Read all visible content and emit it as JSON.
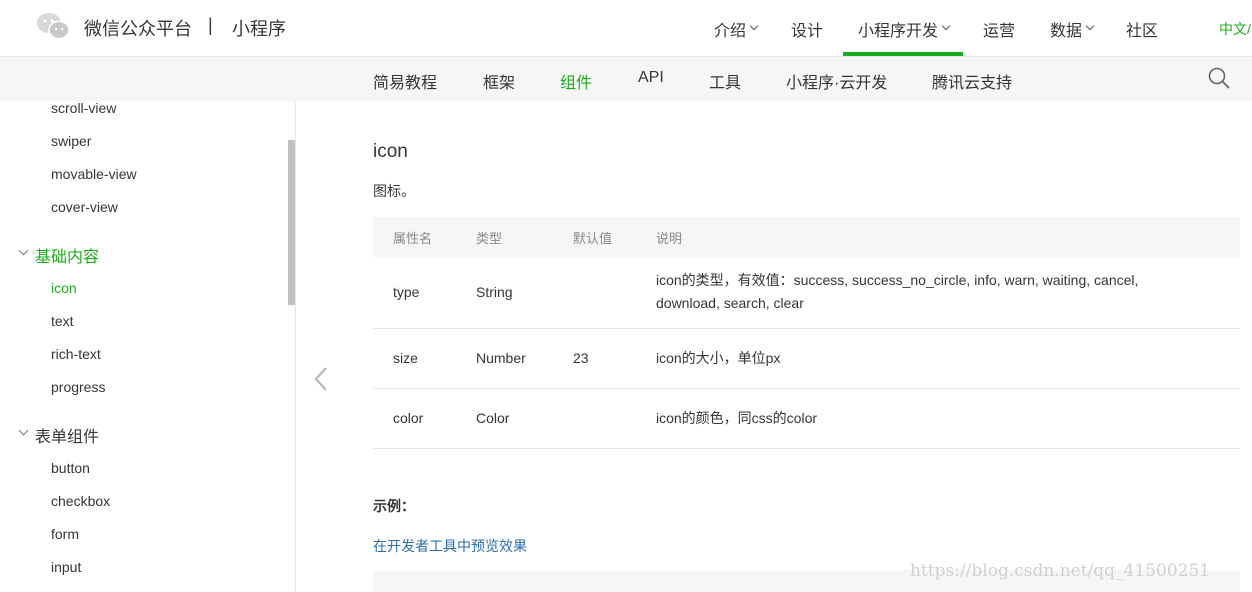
{
  "header": {
    "brand": "微信公众平台",
    "separator": "|",
    "section": "小程序",
    "nav": [
      {
        "label": "介绍",
        "dropdown": true
      },
      {
        "label": "设计",
        "dropdown": false
      },
      {
        "label": "小程序开发",
        "dropdown": true,
        "active": true
      },
      {
        "label": "运营",
        "dropdown": false
      },
      {
        "label": "数据",
        "dropdown": true
      },
      {
        "label": "社区",
        "dropdown": false
      }
    ],
    "lang": "中文/"
  },
  "subnav": {
    "items": [
      "简易教程",
      "框架",
      "组件",
      "API",
      "工具",
      "小程序·云开发",
      "腾讯云支持"
    ],
    "active": "组件"
  },
  "sidebar": {
    "top_items": [
      "scroll-view",
      "swiper",
      "movable-view",
      "cover-view"
    ],
    "group1": {
      "label": "基础内容",
      "items": [
        "icon",
        "text",
        "rich-text",
        "progress"
      ]
    },
    "group2": {
      "label": "表单组件",
      "items": [
        "button",
        "checkbox",
        "form",
        "input"
      ]
    }
  },
  "content": {
    "title": "icon",
    "description": "图标。",
    "table": {
      "headers": [
        "属性名",
        "类型",
        "默认值",
        "说明"
      ],
      "rows": [
        {
          "name": "type",
          "type": "String",
          "default": "",
          "desc": "icon的类型，有效值：success, success_no_circle, info, warn, waiting, cancel, download, search, clear"
        },
        {
          "name": "size",
          "type": "Number",
          "default": "23",
          "desc": "icon的大小，单位px"
        },
        {
          "name": "color",
          "type": "Color",
          "default": "",
          "desc": "icon的颜色，同css的color"
        }
      ]
    },
    "example_label": "示例：",
    "preview_link": "在开发者工具中预览效果"
  },
  "watermark": "https://blog.csdn.net/qq_41500251",
  "colors": {
    "accent": "#1aad19",
    "link": "#2b6cb0"
  }
}
